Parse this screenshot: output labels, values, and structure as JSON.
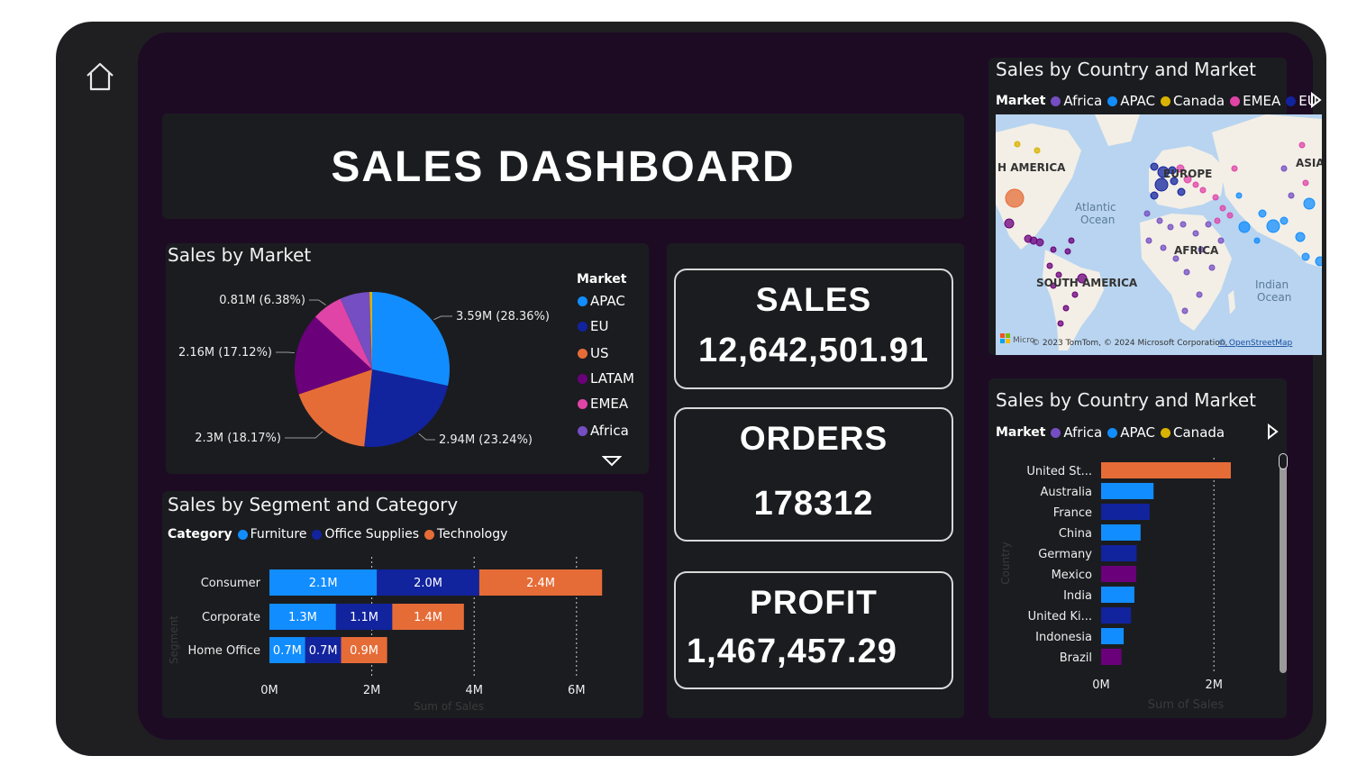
{
  "header": {
    "title": "SALES DASHBOARD"
  },
  "kpis": {
    "sales_label": "SALES",
    "sales_value": "12,642,501.91",
    "orders_label": "ORDERS",
    "orders_value": "178312",
    "profit_label": "PROFIT",
    "profit_value": "1,467,457.29"
  },
  "pie": {
    "title": "Sales by Market",
    "legend_title": "Market",
    "legend": [
      {
        "name": "APAC",
        "color": "#118DFF"
      },
      {
        "name": "EU",
        "color": "#12239E"
      },
      {
        "name": "US",
        "color": "#E66C37"
      },
      {
        "name": "LATAM",
        "color": "#6B007B"
      },
      {
        "name": "EMEA",
        "color": "#E044A7"
      },
      {
        "name": "Africa",
        "color": "#744EC2"
      }
    ]
  },
  "segment": {
    "title": "Sales by Segment and Category",
    "legend_title": "Category",
    "legend": [
      {
        "name": "Furniture",
        "color": "#118DFF"
      },
      {
        "name": "Office Supplies",
        "color": "#12239E"
      },
      {
        "name": "Technology",
        "color": "#E66C37"
      }
    ],
    "ylabel": "Segment",
    "xlabel": "Sum of Sales",
    "ticks": [
      "0M",
      "2M",
      "4M",
      "6M"
    ]
  },
  "map": {
    "title": "Sales by Country and Market",
    "legend_title": "Market",
    "legend": [
      {
        "name": "Africa",
        "color": "#744EC2"
      },
      {
        "name": "APAC",
        "color": "#118DFF"
      },
      {
        "name": "Canada",
        "color": "#D9B300"
      },
      {
        "name": "EMEA",
        "color": "#E044A7"
      },
      {
        "name": "EU",
        "color": "#12239E"
      }
    ],
    "labels": {
      "na": "H AMERICA",
      "europe": "EUROPE",
      "asia": "ASIA",
      "atlantic": "Atlantic\nOcean",
      "africa": "AFRICA",
      "sa": "SOUTH AMERICA",
      "indian": "Indian\nOcean"
    },
    "attribution": "© 2023 TomTom, © 2024 Microsoft Corporation, ",
    "attribution_link": "© OpenStreetMap",
    "brand": "Micro"
  },
  "country": {
    "title": "Sales by Country and Market",
    "legend_title": "Market",
    "legend": [
      {
        "name": "Africa",
        "color": "#744EC2"
      },
      {
        "name": "APAC",
        "color": "#118DFF"
      },
      {
        "name": "Canada",
        "color": "#D9B300"
      }
    ],
    "ylabel": "Country",
    "xlabel": "Sum of Sales",
    "ticks": [
      "0M",
      "2M"
    ]
  },
  "chart_data": [
    {
      "type": "pie",
      "title": "Sales by Market",
      "legend_position": "right",
      "slices": [
        {
          "name": "APAC",
          "value": 3.59,
          "label": "3.59M (28.36%)",
          "color": "#118DFF"
        },
        {
          "name": "EU",
          "value": 2.94,
          "label": "2.94M (23.24%)",
          "color": "#12239E"
        },
        {
          "name": "US",
          "value": 2.3,
          "label": "2.3M (18.17%)",
          "color": "#E66C37"
        },
        {
          "name": "LATAM",
          "value": 2.16,
          "label": "2.16M (17.12%)",
          "color": "#6B007B"
        },
        {
          "name": "EMEA",
          "value": 0.81,
          "label": "0.81M (6.38%)",
          "color": "#E044A7"
        },
        {
          "name": "Africa",
          "value": 0.78,
          "label": "",
          "color": "#744EC2"
        },
        {
          "name": "Canada",
          "value": 0.07,
          "label": "",
          "color": "#D9B300"
        }
      ]
    },
    {
      "type": "bar",
      "orientation": "horizontal",
      "stacked": true,
      "title": "Sales by Segment and Category",
      "categories": [
        "Consumer",
        "Corporate",
        "Home Office"
      ],
      "series": [
        {
          "name": "Furniture",
          "values": [
            2.1,
            1.3,
            0.7
          ],
          "labels": [
            "2.1M",
            "1.3M",
            "0.7M"
          ],
          "color": "#118DFF"
        },
        {
          "name": "Office Supplies",
          "values": [
            2.0,
            1.1,
            0.7
          ],
          "labels": [
            "2.0M",
            "1.1M",
            "0.7M"
          ],
          "color": "#12239E"
        },
        {
          "name": "Technology",
          "values": [
            2.4,
            1.4,
            0.9
          ],
          "labels": [
            "2.4M",
            "1.4M",
            "0.9M"
          ],
          "color": "#E66C37"
        }
      ],
      "xlim": [
        0,
        6.8
      ],
      "xlabel": "Sum of Sales",
      "ylabel": "Segment",
      "unit": "M"
    },
    {
      "type": "bar",
      "orientation": "horizontal",
      "title": "Sales by Country and Market",
      "categories": [
        "United St...",
        "Australia",
        "France",
        "China",
        "Germany",
        "Mexico",
        "India",
        "United Ki...",
        "Indonesia",
        "Brazil"
      ],
      "values": [
        2.3,
        0.93,
        0.86,
        0.7,
        0.63,
        0.62,
        0.59,
        0.53,
        0.4,
        0.36
      ],
      "colors": [
        "#E66C37",
        "#118DFF",
        "#12239E",
        "#118DFF",
        "#12239E",
        "#6B007B",
        "#118DFF",
        "#12239E",
        "#118DFF",
        "#6B007B"
      ],
      "xlim": [
        0,
        2.4
      ],
      "xlabel": "Sum of Sales",
      "ylabel": "Country",
      "unit": "M"
    }
  ]
}
